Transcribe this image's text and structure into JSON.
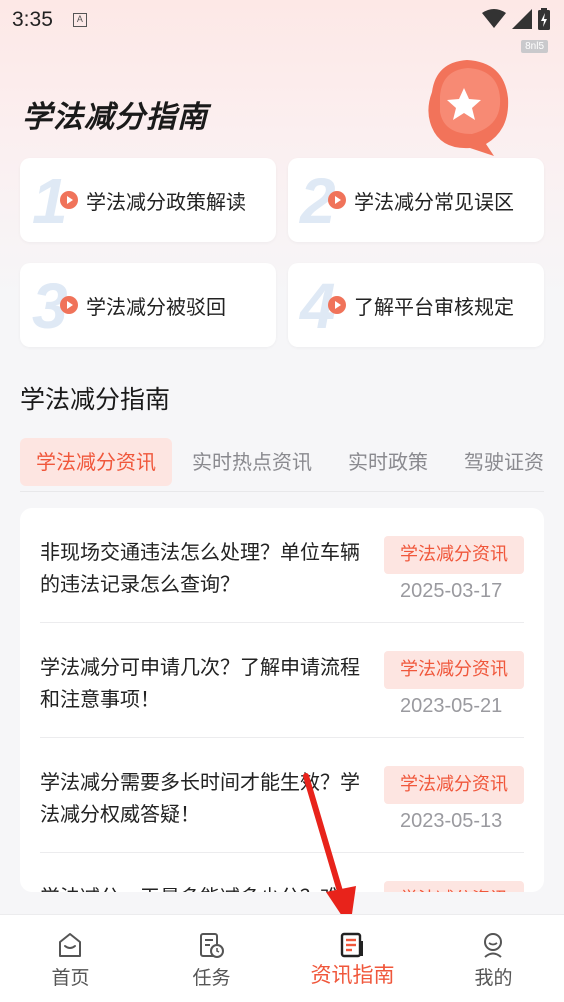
{
  "status_bar": {
    "time": "3:35",
    "indicator": "A",
    "watermark": "8nl5"
  },
  "hero": {
    "title": "学法减分指南"
  },
  "features": [
    {
      "num": "1",
      "label": "学法减分政策解读"
    },
    {
      "num": "2",
      "label": "学法减分常见误区"
    },
    {
      "num": "3",
      "label": "学法减分被驳回"
    },
    {
      "num": "4",
      "label": "了解平台审核规定"
    }
  ],
  "section": {
    "title": "学法减分指南"
  },
  "tabs": [
    "学法减分资讯",
    "实时热点资讯",
    "实时政策",
    "驾驶证资"
  ],
  "news": [
    {
      "title": "非现场交通违法怎么处理？单位车辆的违法记录怎么查询？",
      "tag": "学法减分资讯",
      "date": "2025-03-17"
    },
    {
      "title": "学法减分可申请几次？了解申请流程和注意事项！",
      "tag": "学法减分资讯",
      "date": "2023-05-21"
    },
    {
      "title": "学法减分需要多长时间才能生效？学法减分权威答疑！",
      "tag": "学法减分资讯",
      "date": "2023-05-13"
    },
    {
      "title": "学法减分一天最多能减多少分？难",
      "tag": "学法减分资讯",
      "date": ""
    }
  ],
  "bottom_nav": [
    {
      "label": "首页",
      "icon": "home-icon"
    },
    {
      "label": "任务",
      "icon": "task-icon"
    },
    {
      "label": "资讯指南",
      "icon": "news-guide-icon"
    },
    {
      "label": "我的",
      "icon": "profile-icon"
    }
  ],
  "colors": {
    "accent": "#f0573b",
    "tag_bg": "#fde5e1",
    "arrow": "#e8231b"
  }
}
